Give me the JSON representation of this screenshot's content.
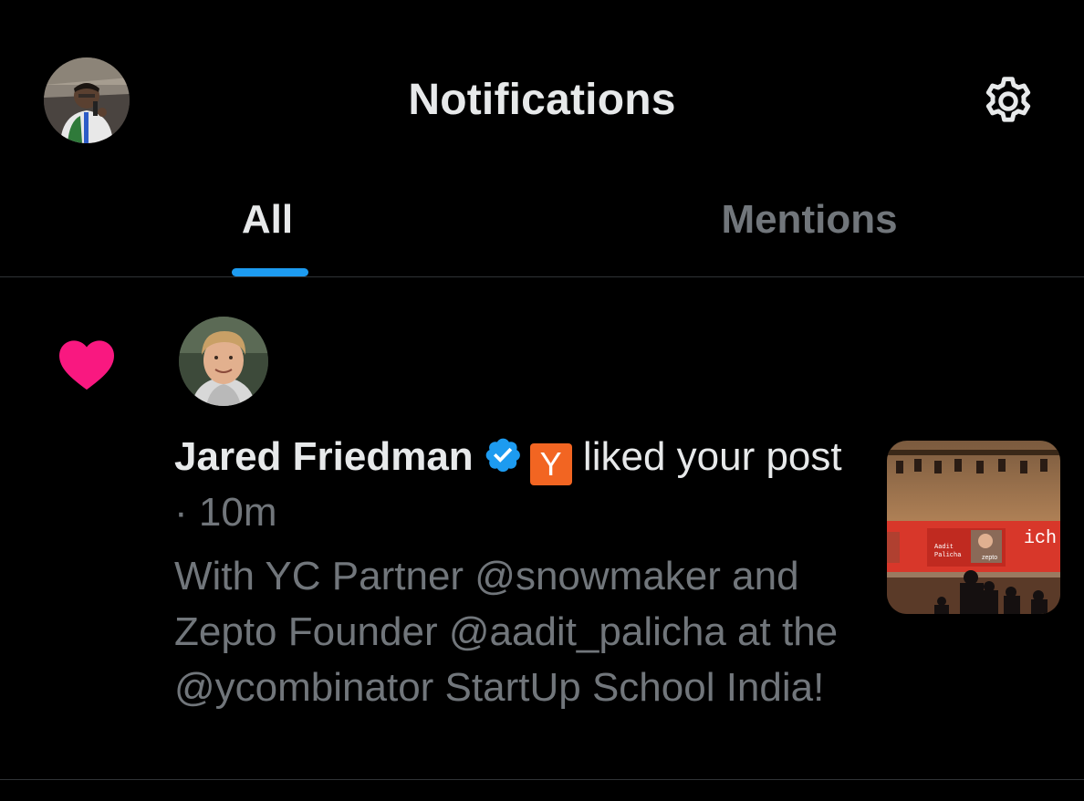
{
  "header": {
    "title": "Notifications"
  },
  "tabs": [
    {
      "label": "All",
      "active": true
    },
    {
      "label": "Mentions",
      "active": false
    }
  ],
  "notification": {
    "user_name": "Jared Friedman",
    "badge_letter": "Y",
    "action_text": "liked your post",
    "separator": "·",
    "time": "10m",
    "post_text": "With YC Partner @snowmaker and Zepto Founder @aadit_palicha at the @ycombinator StartUp School India!",
    "thumbnail": {
      "screen_lines": [
        "Aadit",
        "Palicha"
      ],
      "brand": "zepto",
      "side_text": "ich"
    }
  },
  "colors": {
    "background": "#000000",
    "text_primary": "#e7e9ea",
    "text_secondary": "#71767b",
    "accent_blue": "#1d9bf0",
    "heart_pink": "#f91880",
    "yc_orange": "#f26522",
    "divider": "#2f3336"
  },
  "icons": {
    "settings": "gear-icon",
    "like": "heart-icon",
    "verified": "verified-badge-icon"
  }
}
